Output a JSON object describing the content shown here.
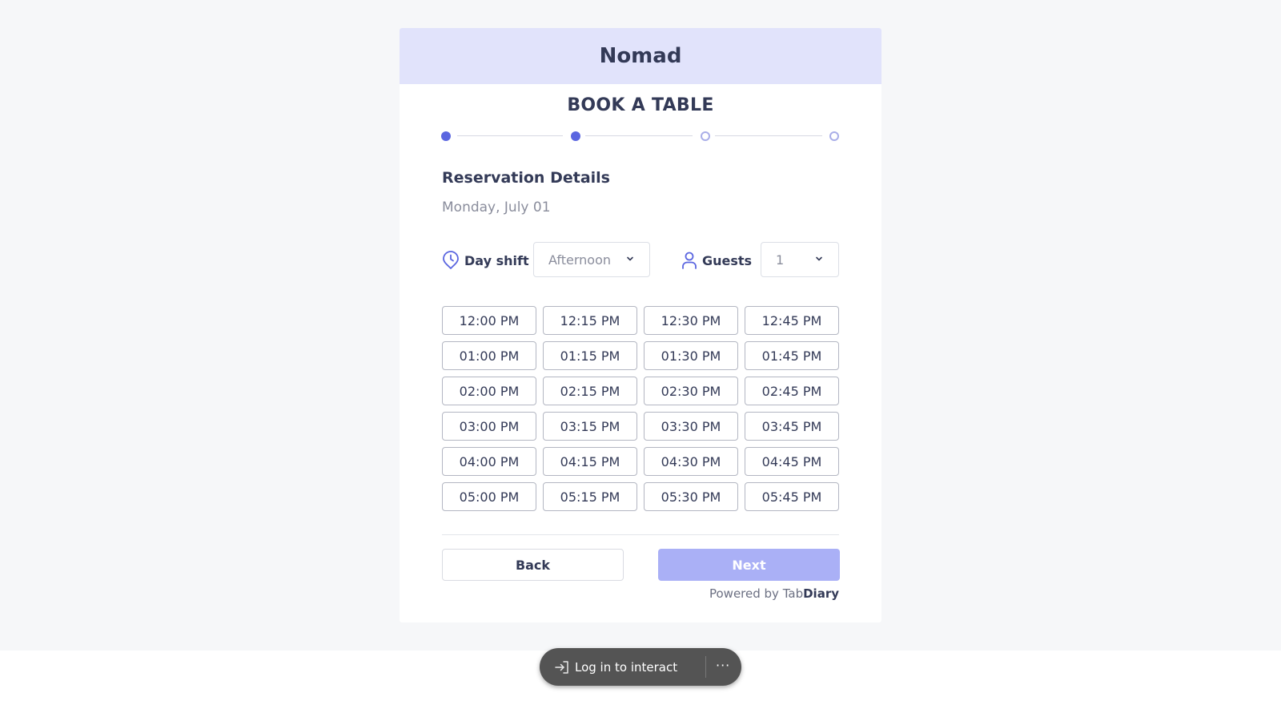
{
  "restaurant_name": "Nomad",
  "booking_title": "BOOK A TABLE",
  "stepper": {
    "total_steps": 4,
    "completed_steps": 2
  },
  "section_title": "Reservation Details",
  "date": "Monday, July 01",
  "day_shift": {
    "label": "Day shift",
    "value": "Afternoon",
    "icon": "clock-pin-icon"
  },
  "guests": {
    "label": "Guests",
    "value": "1",
    "icon": "person-icon"
  },
  "time_slots": [
    "12:00 PM",
    "12:15 PM",
    "12:30 PM",
    "12:45 PM",
    "01:00 PM",
    "01:15 PM",
    "01:30 PM",
    "01:45 PM",
    "02:00 PM",
    "02:15 PM",
    "02:30 PM",
    "02:45 PM",
    "03:00 PM",
    "03:15 PM",
    "03:30 PM",
    "03:45 PM",
    "04:00 PM",
    "04:15 PM",
    "04:30 PM",
    "04:45 PM",
    "05:00 PM",
    "05:15 PM",
    "05:30 PM",
    "05:45 PM"
  ],
  "buttons": {
    "back": "Back",
    "next": "Next"
  },
  "powered_by": {
    "prefix": "Powered by ",
    "brand_light": "Tab",
    "brand_bold": "Diary"
  },
  "login_bar": {
    "label": "Log in to interact",
    "more": "···"
  },
  "colors": {
    "accent": "#5b66e0",
    "header_bg": "#e1e3fb",
    "next_button_bg": "#aab0f6",
    "text_dark": "#333a57"
  }
}
